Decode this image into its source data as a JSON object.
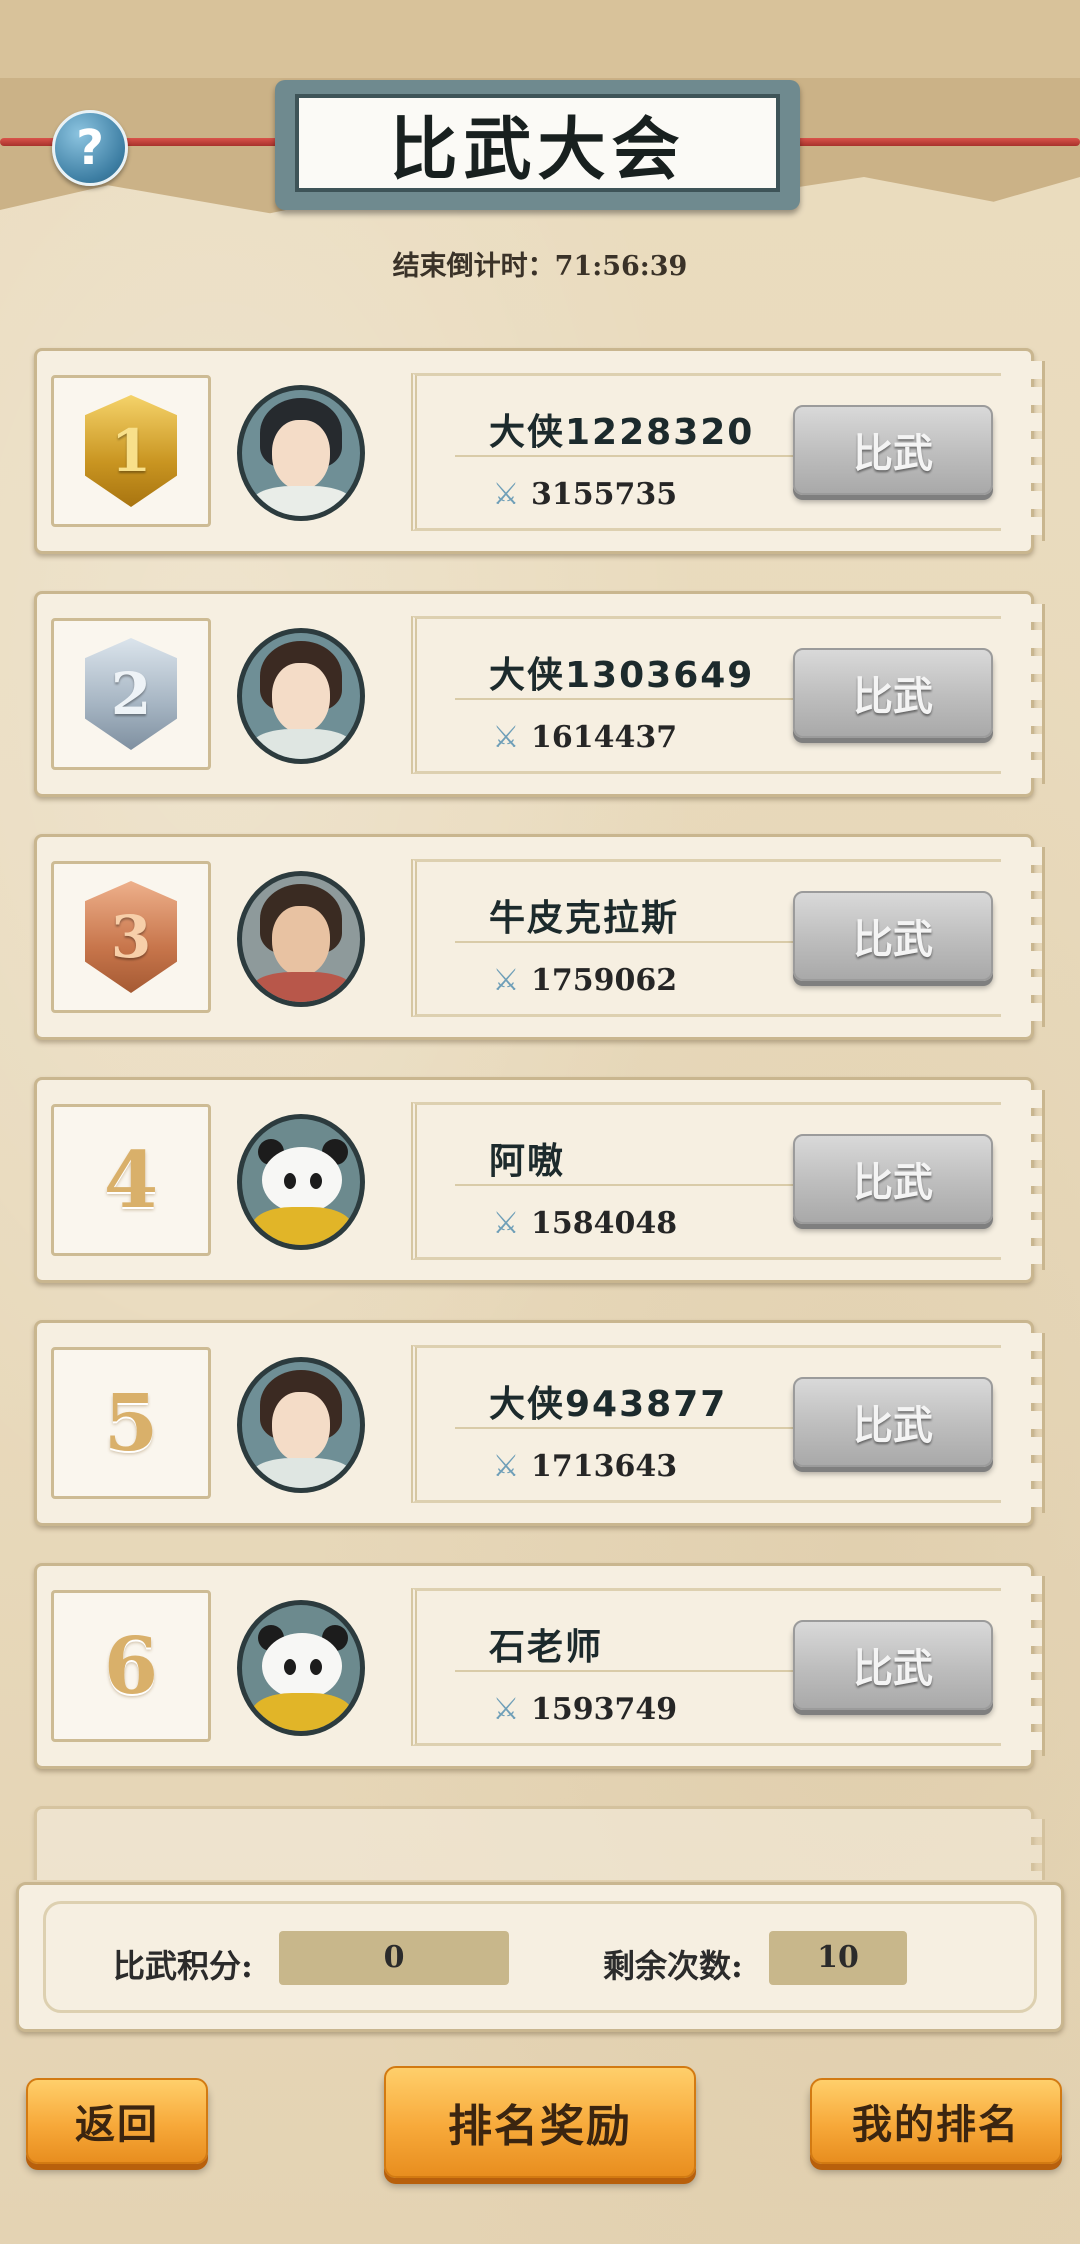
{
  "header": {
    "title": "比武大会",
    "help_icon": "question-mark-icon",
    "countdown_label": "结束倒计时：",
    "countdown_value": "71:56:39"
  },
  "ranking": {
    "duel_label": "比武",
    "power_icon": "crossed-swords-icon",
    "rows": [
      {
        "rank": "1",
        "medal": "gold",
        "name": "大侠1228320",
        "power": "3155735"
      },
      {
        "rank": "2",
        "medal": "silver",
        "name": "大侠1303649",
        "power": "1614437"
      },
      {
        "rank": "3",
        "medal": "bronze",
        "name": "牛皮克拉斯",
        "power": "1759062"
      },
      {
        "rank": "4",
        "medal": "",
        "name": "阿嗷",
        "power": "1584048"
      },
      {
        "rank": "5",
        "medal": "",
        "name": "大侠943877",
        "power": "1713643"
      },
      {
        "rank": "6",
        "medal": "",
        "name": "石老师",
        "power": "1593749"
      }
    ]
  },
  "stats": {
    "score_label": "比武积分:",
    "score_value": "0",
    "remaining_label": "剩余次数:",
    "remaining_value": "10"
  },
  "footer": {
    "back_label": "返回",
    "reward_label": "排名奖励",
    "my_rank_label": "我的排名"
  },
  "colors": {
    "duel_button": "#bdbdbd",
    "orange_button": "#f7a93a",
    "background": "#e8d9bb"
  }
}
